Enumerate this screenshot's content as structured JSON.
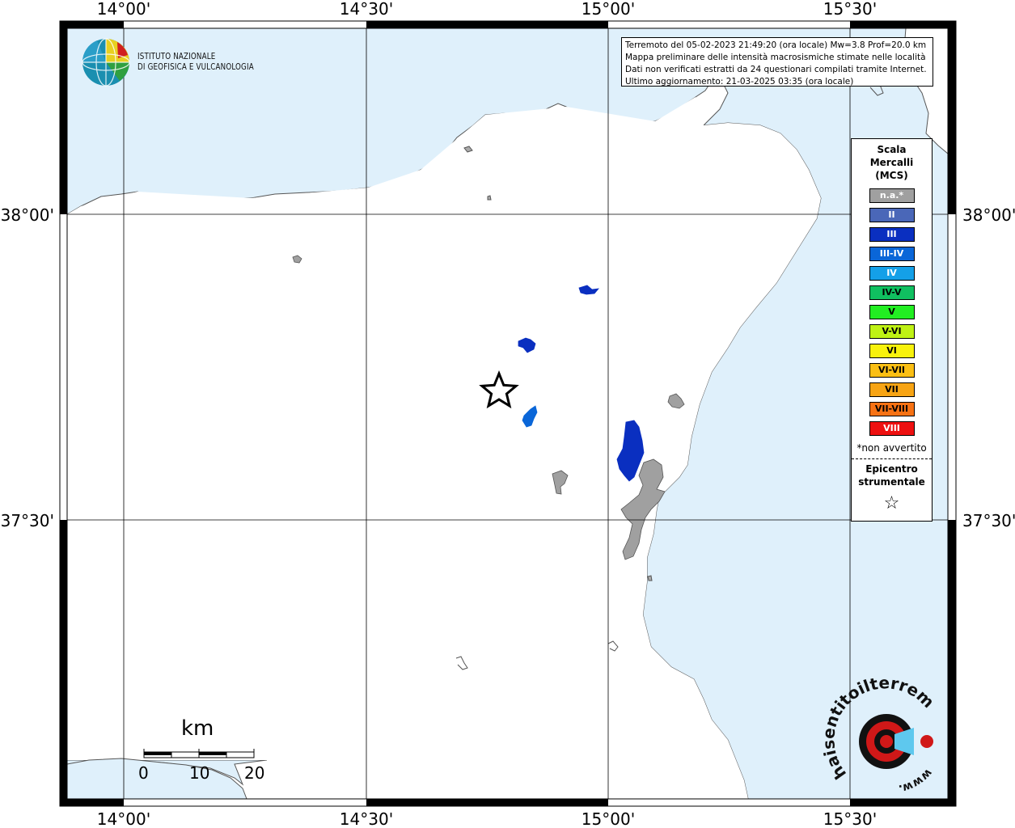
{
  "map": {
    "top_labels": [
      "14°00'",
      "14°30'",
      "15°00'",
      "15°30'"
    ],
    "bottom_labels": [
      "14°00'",
      "14°30'",
      "15°00'",
      "15°30'"
    ],
    "left_labels": [
      "38°00'",
      "37°30'"
    ],
    "right_labels": [
      "38°00'",
      "37°30'"
    ],
    "colors": {
      "sea": "#dff0fb",
      "land": "#ffffff",
      "grid": "#000000"
    }
  },
  "info": {
    "line1": "Terremoto del 05-02-2023 21:49:20 (ora locale) Mw=3.8 Prof=20.0 km",
    "line2": "Mappa preliminare delle intensità macrosismiche stimate nelle località",
    "line3": "Dati non verificati estratti da 24 questionari compilati tramite Internet.",
    "line4": "Ultimo aggiornamento: 21-03-2025 03:35 (ora locale)"
  },
  "logo": {
    "line1": "ISTITUTO NAZIONALE",
    "line2": "DI GEOFISICA E VULCANOLOGIA"
  },
  "legend": {
    "title1": "Scala",
    "title2": "Mercalli",
    "title3": "(MCS)",
    "items": [
      {
        "label": "n.a.*",
        "color": "#a0a0a0",
        "text": "#ffffff"
      },
      {
        "label": "II",
        "color": "#4a67b8",
        "text": "#ffffff"
      },
      {
        "label": "III",
        "color": "#0a2fc0",
        "text": "#ffffff"
      },
      {
        "label": "III-IV",
        "color": "#0a66d8",
        "text": "#ffffff"
      },
      {
        "label": "IV",
        "color": "#14a0e8",
        "text": "#ffffff"
      },
      {
        "label": "IV-V",
        "color": "#10c060",
        "text": "#000000"
      },
      {
        "label": "V",
        "color": "#22ee22",
        "text": "#000000"
      },
      {
        "label": "V-VI",
        "color": "#bff214",
        "text": "#000000"
      },
      {
        "label": "VI",
        "color": "#f8f20c",
        "text": "#000000"
      },
      {
        "label": "VI-VII",
        "color": "#fbbf14",
        "text": "#000000"
      },
      {
        "label": "VII",
        "color": "#f7a414",
        "text": "#000000"
      },
      {
        "label": "VII-VIII",
        "color": "#f77214",
        "text": "#000000"
      },
      {
        "label": "VIII",
        "color": "#ee1010",
        "text": "#ffffff"
      }
    ],
    "note": "*non avvertito",
    "epicenter1": "Epicentro",
    "epicenter2": "strumentale",
    "star": "☆"
  },
  "scale": {
    "unit": "km",
    "labels": [
      "0",
      "10",
      "20"
    ]
  },
  "watermark": {
    "domain": "haisentitoilterremoto.it",
    "prefix": "www."
  }
}
